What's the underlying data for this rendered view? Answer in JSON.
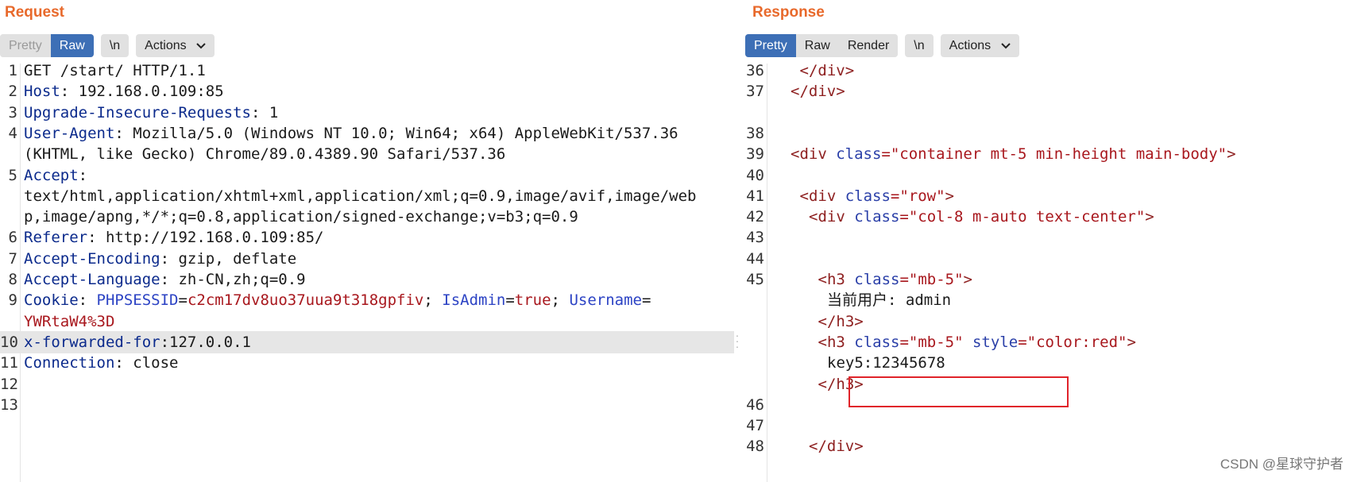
{
  "request": {
    "title": "Request",
    "toolbar": {
      "pretty": "Pretty",
      "raw": "Raw",
      "newline": "\\n",
      "actions": "Actions"
    },
    "lines": [
      {
        "num": "1",
        "parts": [
          {
            "t": "GET /start/ HTTP/1.1",
            "c": "v"
          }
        ]
      },
      {
        "num": "2",
        "parts": [
          {
            "t": "Host",
            "c": "k"
          },
          {
            "t": ": 192.168.0.109:85",
            "c": "v"
          }
        ]
      },
      {
        "num": "3",
        "parts": [
          {
            "t": "Upgrade-Insecure-Requests",
            "c": "k"
          },
          {
            "t": ": 1",
            "c": "v"
          }
        ]
      },
      {
        "num": "4",
        "parts": [
          {
            "t": "User-Agent",
            "c": "k"
          },
          {
            "t": ": Mozilla/5.0 (Windows NT 10.0; Win64; x64) AppleWebKit/537.36",
            "c": "v"
          }
        ]
      },
      {
        "num": "",
        "parts": [
          {
            "t": "(KHTML, like Gecko) Chrome/89.0.4389.90 Safari/537.36",
            "c": "v"
          }
        ]
      },
      {
        "num": "5",
        "parts": [
          {
            "t": "Accept",
            "c": "k"
          },
          {
            "t": ":",
            "c": "v"
          }
        ]
      },
      {
        "num": "",
        "parts": [
          {
            "t": "text/html,application/xhtml+xml,application/xml;q=0.9,image/avif,image/web",
            "c": "v"
          }
        ]
      },
      {
        "num": "",
        "parts": [
          {
            "t": "p,image/apng,*/*;q=0.8,application/signed-exchange;v=b3;q=0.9",
            "c": "v"
          }
        ]
      },
      {
        "num": "6",
        "parts": [
          {
            "t": "Referer",
            "c": "k"
          },
          {
            "t": ": http://192.168.0.109:85/",
            "c": "v"
          }
        ]
      },
      {
        "num": "7",
        "parts": [
          {
            "t": "Accept-Encoding",
            "c": "k"
          },
          {
            "t": ": gzip, deflate",
            "c": "v"
          }
        ]
      },
      {
        "num": "8",
        "parts": [
          {
            "t": "Accept-Language",
            "c": "k"
          },
          {
            "t": ": zh-CN,zh;q=0.9",
            "c": "v"
          }
        ]
      },
      {
        "num": "9",
        "parts": [
          {
            "t": "Cookie",
            "c": "k"
          },
          {
            "t": ": ",
            "c": "v"
          },
          {
            "t": "PHPSESSID",
            "c": "b"
          },
          {
            "t": "=",
            "c": "v"
          },
          {
            "t": "c2cm17dv8uo37uua9t318gpfiv",
            "c": "r"
          },
          {
            "t": "; ",
            "c": "v"
          },
          {
            "t": "IsAdmin",
            "c": "b"
          },
          {
            "t": "=",
            "c": "v"
          },
          {
            "t": "true",
            "c": "r"
          },
          {
            "t": "; ",
            "c": "v"
          },
          {
            "t": "Username",
            "c": "b"
          },
          {
            "t": "=",
            "c": "v"
          }
        ]
      },
      {
        "num": "",
        "parts": [
          {
            "t": "YWRtaW4%3D",
            "c": "r"
          }
        ]
      },
      {
        "num": "10",
        "highlight": true,
        "parts": [
          {
            "t": "x-forwarded-for",
            "c": "k"
          },
          {
            "t": ":127.0.0.1",
            "c": "v"
          }
        ]
      },
      {
        "num": "11",
        "parts": [
          {
            "t": "Connection",
            "c": "k"
          },
          {
            "t": ": close",
            "c": "v"
          }
        ]
      },
      {
        "num": "12",
        "parts": []
      },
      {
        "num": "13",
        "parts": []
      }
    ]
  },
  "response": {
    "title": "Response",
    "toolbar": {
      "pretty": "Pretty",
      "raw": "Raw",
      "render": "Render",
      "newline": "\\n",
      "actions": "Actions"
    },
    "lines": [
      {
        "num": "36",
        "indent": 3,
        "parts": [
          {
            "t": "</div>",
            "c": "tag"
          }
        ]
      },
      {
        "num": "37",
        "indent": 2,
        "parts": [
          {
            "t": "</div>",
            "c": "tag"
          }
        ]
      },
      {
        "num": "",
        "indent": 0,
        "parts": []
      },
      {
        "num": "38",
        "indent": 0,
        "parts": []
      },
      {
        "num": "39",
        "indent": 2,
        "parts": [
          {
            "t": "<div ",
            "c": "tag"
          },
          {
            "t": "class",
            "c": "attr"
          },
          {
            "t": "=\"container mt-5 min-height main-body\"",
            "c": "str"
          },
          {
            "t": ">",
            "c": "tag"
          }
        ]
      },
      {
        "num": "40",
        "indent": 0,
        "parts": []
      },
      {
        "num": "41",
        "indent": 3,
        "parts": [
          {
            "t": "<div ",
            "c": "tag"
          },
          {
            "t": "class",
            "c": "attr"
          },
          {
            "t": "=\"row\"",
            "c": "str"
          },
          {
            "t": ">",
            "c": "tag"
          }
        ]
      },
      {
        "num": "42",
        "indent": 4,
        "parts": [
          {
            "t": "<div ",
            "c": "tag"
          },
          {
            "t": "class",
            "c": "attr"
          },
          {
            "t": "=\"col-8 m-auto text-center\"",
            "c": "str"
          },
          {
            "t": ">",
            "c": "tag"
          }
        ]
      },
      {
        "num": "43",
        "indent": 0,
        "parts": []
      },
      {
        "num": "44",
        "indent": 0,
        "parts": []
      },
      {
        "num": "45",
        "indent": 5,
        "parts": [
          {
            "t": "<h3 ",
            "c": "tag"
          },
          {
            "t": "class",
            "c": "attr"
          },
          {
            "t": "=\"mb-5\"",
            "c": "str"
          },
          {
            "t": ">",
            "c": "tag"
          }
        ]
      },
      {
        "num": "",
        "indent": 6,
        "parts": [
          {
            "t": "当前用户: admin",
            "c": "txt"
          }
        ]
      },
      {
        "num": "",
        "indent": 5,
        "parts": [
          {
            "t": "</h3>",
            "c": "tag"
          }
        ]
      },
      {
        "num": "",
        "indent": 5,
        "parts": [
          {
            "t": "<h3 ",
            "c": "tag"
          },
          {
            "t": "class",
            "c": "attr"
          },
          {
            "t": "=\"mb-5\" ",
            "c": "str"
          },
          {
            "t": "style",
            "c": "attr"
          },
          {
            "t": "=\"color:red\"",
            "c": "str"
          },
          {
            "t": ">",
            "c": "tag"
          }
        ]
      },
      {
        "num": "",
        "indent": 6,
        "parts": [
          {
            "t": "key5:12345678",
            "c": "txt"
          }
        ]
      },
      {
        "num": "",
        "indent": 5,
        "parts": [
          {
            "t": "</h3>",
            "c": "tag"
          }
        ]
      },
      {
        "num": "46",
        "indent": 0,
        "parts": []
      },
      {
        "num": "47",
        "indent": 0,
        "parts": []
      },
      {
        "num": "48",
        "indent": 4,
        "parts": [
          {
            "t": "</div>",
            "c": "tag"
          }
        ]
      }
    ]
  },
  "watermark": "CSDN @星球守护者",
  "colors": {
    "accent_orange": "#e8692b",
    "active_tab": "#3d6fb6",
    "highlight_box": "#e0232a"
  }
}
